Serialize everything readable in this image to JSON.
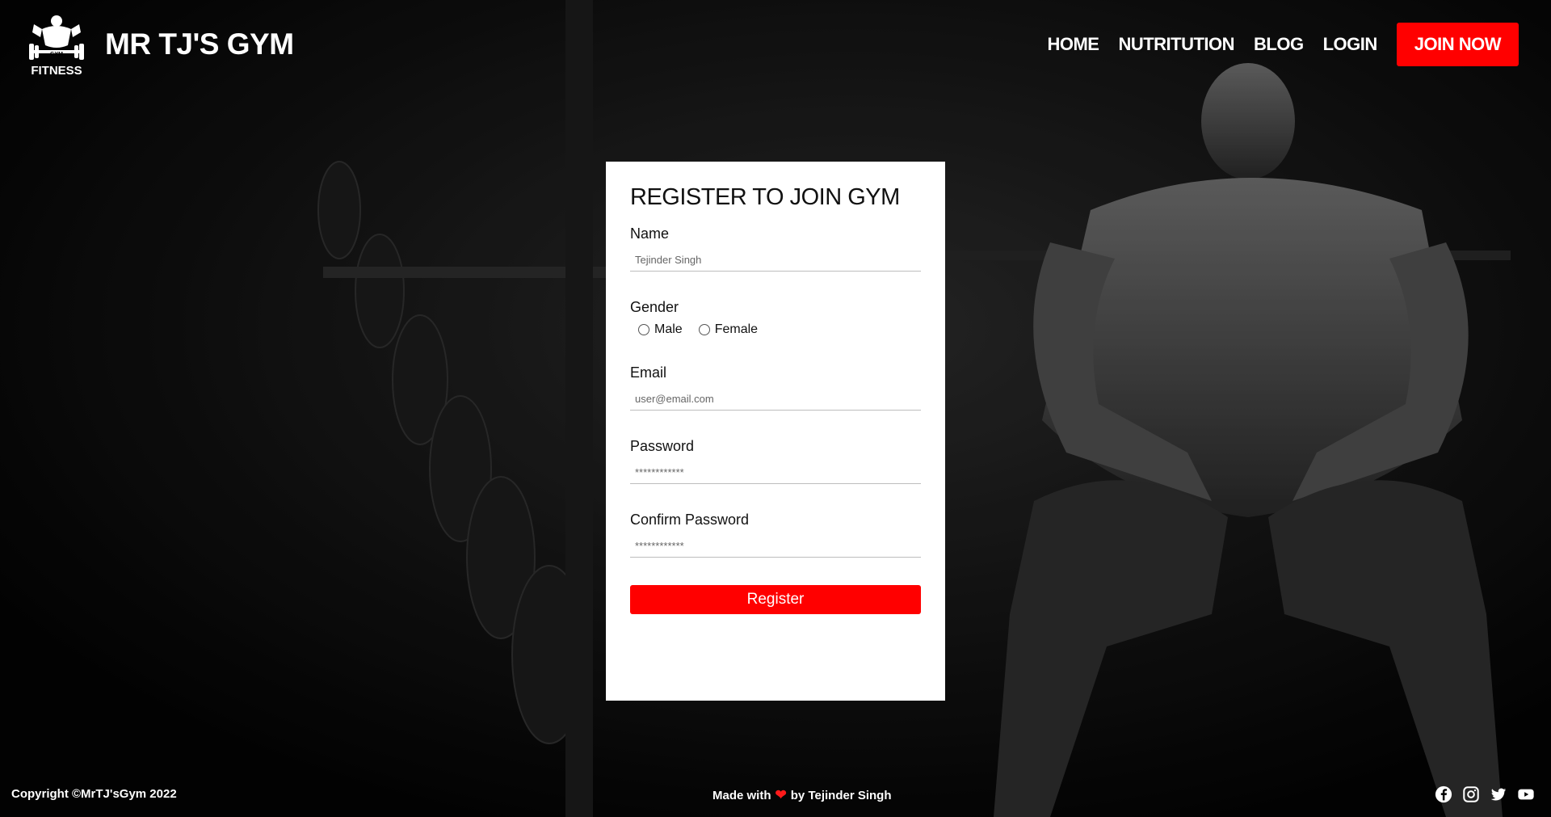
{
  "brand": {
    "logo_text_top": "GYM",
    "logo_text_bottom": "FITNESS",
    "name": "MR TJ'S GYM"
  },
  "nav": {
    "home": "HOME",
    "nutrition": "NUTRITUTION",
    "blog": "BLOG",
    "login": "LOGIN",
    "join": "JOIN NOW"
  },
  "form": {
    "title": "REGISTER TO JOIN GYM",
    "name_label": "Name",
    "name_placeholder": "Tejinder Singh",
    "gender_label": "Gender",
    "gender_options": [
      "Male",
      "Female"
    ],
    "email_label": "Email",
    "email_placeholder": "user@email.com",
    "password_label": "Password",
    "password_placeholder": "************",
    "confirm_label": "Confirm Password",
    "confirm_placeholder": "************",
    "submit": "Register"
  },
  "footer": {
    "copyright": "Copyright ©MrTJ'sGym 2022",
    "made_with": "Made with",
    "by": "by Tejinder Singh",
    "social": [
      "facebook-icon",
      "instagram-icon",
      "twitter-icon",
      "youtube-icon"
    ]
  },
  "colors": {
    "accent": "#ff0000",
    "background": "#050505",
    "card": "#ffffff"
  }
}
